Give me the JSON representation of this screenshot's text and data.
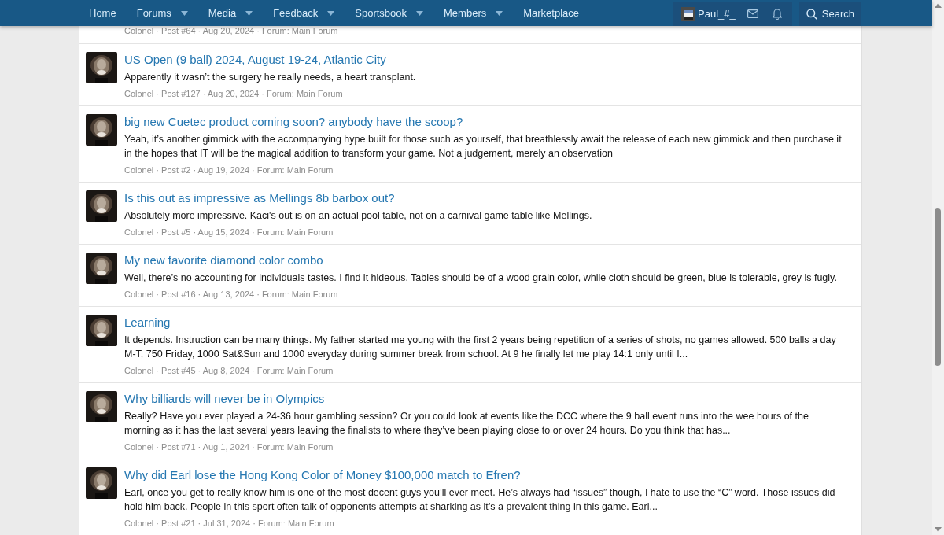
{
  "nav": {
    "items": [
      {
        "label": "Home",
        "dropdown": false
      },
      {
        "label": "Forums",
        "dropdown": true
      },
      {
        "label": "Media",
        "dropdown": true
      },
      {
        "label": "Feedback",
        "dropdown": true
      },
      {
        "label": "Sportsbook",
        "dropdown": true
      },
      {
        "label": "Members",
        "dropdown": true
      },
      {
        "label": "Marketplace",
        "dropdown": false
      }
    ],
    "user": {
      "name": "Paul_#_"
    },
    "search": {
      "label": "Search"
    }
  },
  "partial_result": {
    "meta": "Colonel · Post #64 · Aug 20, 2024 · Forum: Main Forum"
  },
  "results": [
    {
      "title": "US Open (9 ball) 2024, August 19-24, Atlantic City",
      "snippet": "Apparently it wasn’t the surgery he really needs, a heart transplant.",
      "meta": "Colonel · Post #127 · Aug 20, 2024 · Forum: Main Forum"
    },
    {
      "title": "big new Cuetec product coming soon? anybody have the scoop?",
      "snippet": "Yeah, it’s another gimmick with the accompanying hype built for those such as yourself, that breathlessly await the release of each new gimmick and then purchase it in the hopes that IT will be the magical addition to transform your game. Not a judgement, merely an observation",
      "meta": "Colonel · Post #2 · Aug 19, 2024 · Forum: Main Forum"
    },
    {
      "title": "Is this out as impressive as Mellings 8b barbox out?",
      "snippet": "Absolutely more impressive. Kaci's out is on an actual pool table, not on a carnival game table like Mellings.",
      "meta": "Colonel · Post #5 · Aug 15, 2024 · Forum: Main Forum"
    },
    {
      "title": "My new favorite diamond color combo",
      "snippet": "Well, there’s no accounting for individuals tastes. I find it hideous. Tables should be of a wood grain color, while cloth should be green, blue is tolerable, grey is fugly.",
      "meta": "Colonel · Post #16 · Aug 13, 2024 · Forum: Main Forum"
    },
    {
      "title": "Learning",
      "snippet": "It depends. Instruction can be many things. My father started me young with the first 2 years being repetition of a series of shots, no games allowed. 500 balls a day M-T, 750 Friday, 1000 Sat&Sun and 1000 everyday during summer break from school. At 9 he finally let me play 14:1 only until I...",
      "meta": "Colonel · Post #45 · Aug 8, 2024 · Forum: Main Forum"
    },
    {
      "title": "Why billiards will never be in Olympics",
      "snippet": "Really? Have you ever played a 24-36 hour gambling session? Or you could look at events like the DCC where the 9 ball event runs into the wee hours of the morning as it has the last several years leaving the finalists to where they’ve been playing close to or over 24 hours. Do you think that has...",
      "meta": "Colonel · Post #71 · Aug 1, 2024 · Forum: Main Forum"
    },
    {
      "title": "Why did Earl lose the Hong Kong Color of Money $100,000 match to Efren?",
      "snippet": "Earl, once you get to really know him is one of the most decent guys you’ll ever meet. He’s always had “issues” though, I hate to use the “C” word. Those issues did hold him back. People in this sport often talk of opponents attempts at sharking as it’s a prevalent thing in this game. Earl...",
      "meta": "Colonel · Post #21 · Jul 31, 2024 · Forum: Main Forum"
    }
  ]
}
